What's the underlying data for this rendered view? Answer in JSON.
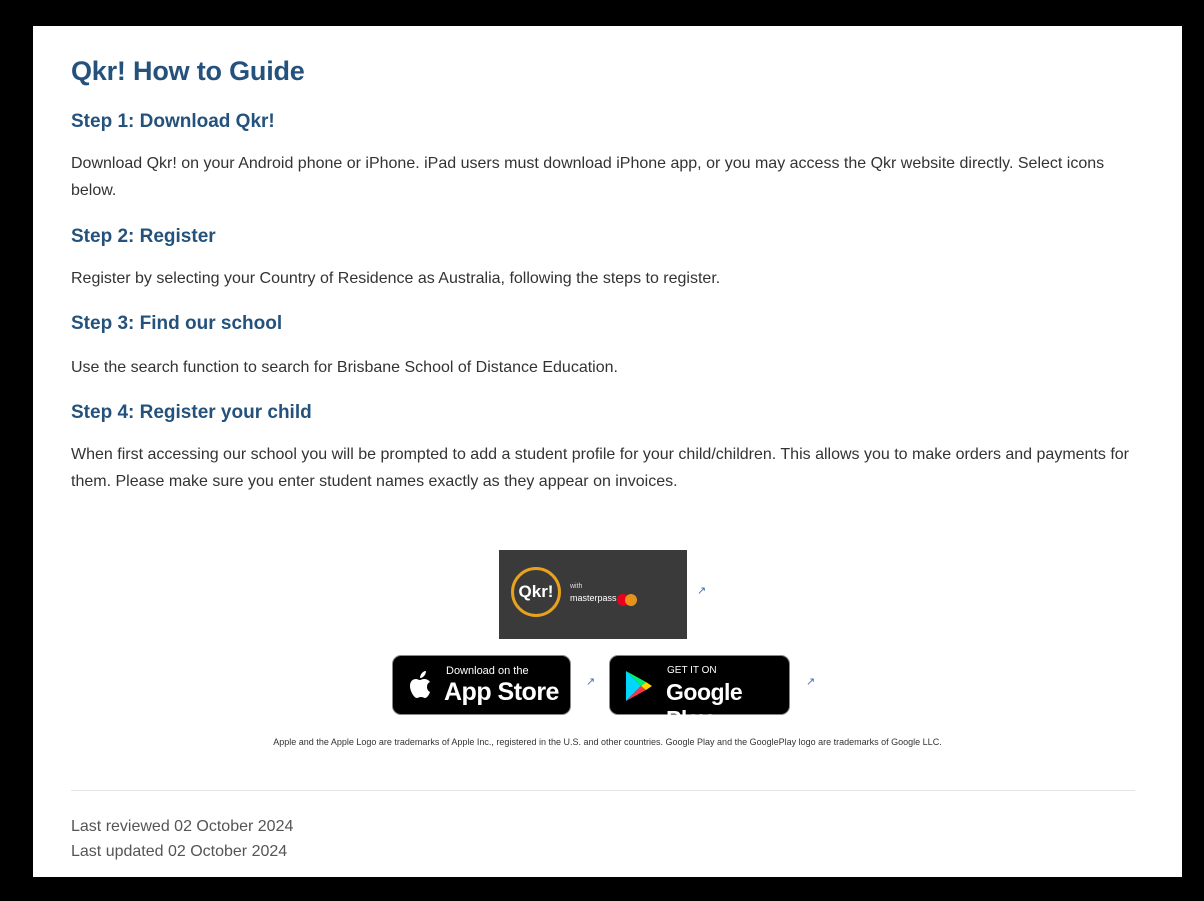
{
  "page_title": "Qkr! How to Guide",
  "steps": [
    {
      "heading": "Step 1: Download Qkr!",
      "body": "Download Qkr! on your Android phone or iPhone. iPad users must download iPhone app, or you may access the Qkr website directly. Select icons below."
    },
    {
      "heading": "Step 2: Register",
      "body": "Register by selecting your Country of Residence as Australia, following the steps to register."
    },
    {
      "heading": "Step 3: Find our school",
      "body": "Use the search function to search for Brisbane School of Distance Education."
    },
    {
      "heading": "Step 4: Register your child",
      "body": "When first accessing our school you will be prompted to add a student profile for your child/children. This allows you to make orders and payments for them. Please make sure you enter student names exactly as they appear on invoices."
    }
  ],
  "qkr_badge": {
    "logo_text": "Qkr!",
    "with_text": "with",
    "masterpass_text": "masterpass"
  },
  "app_store": {
    "small": "Download on the",
    "big": "App Store"
  },
  "google_play": {
    "small": "GET IT ON",
    "big": "Google Play"
  },
  "external_icon": "external-link-icon",
  "trademark": "Apple and the Apple Logo are trademarks of Apple Inc., registered in the U.S. and other countries. Google Play and the GooglePlay logo are trademarks of Google LLC.",
  "meta": {
    "reviewed": "Last reviewed 02 October 2024",
    "updated": "Last updated 02 October 2024"
  },
  "colors": {
    "heading": "#24527c",
    "background": "#000000",
    "card": "#ffffff"
  }
}
